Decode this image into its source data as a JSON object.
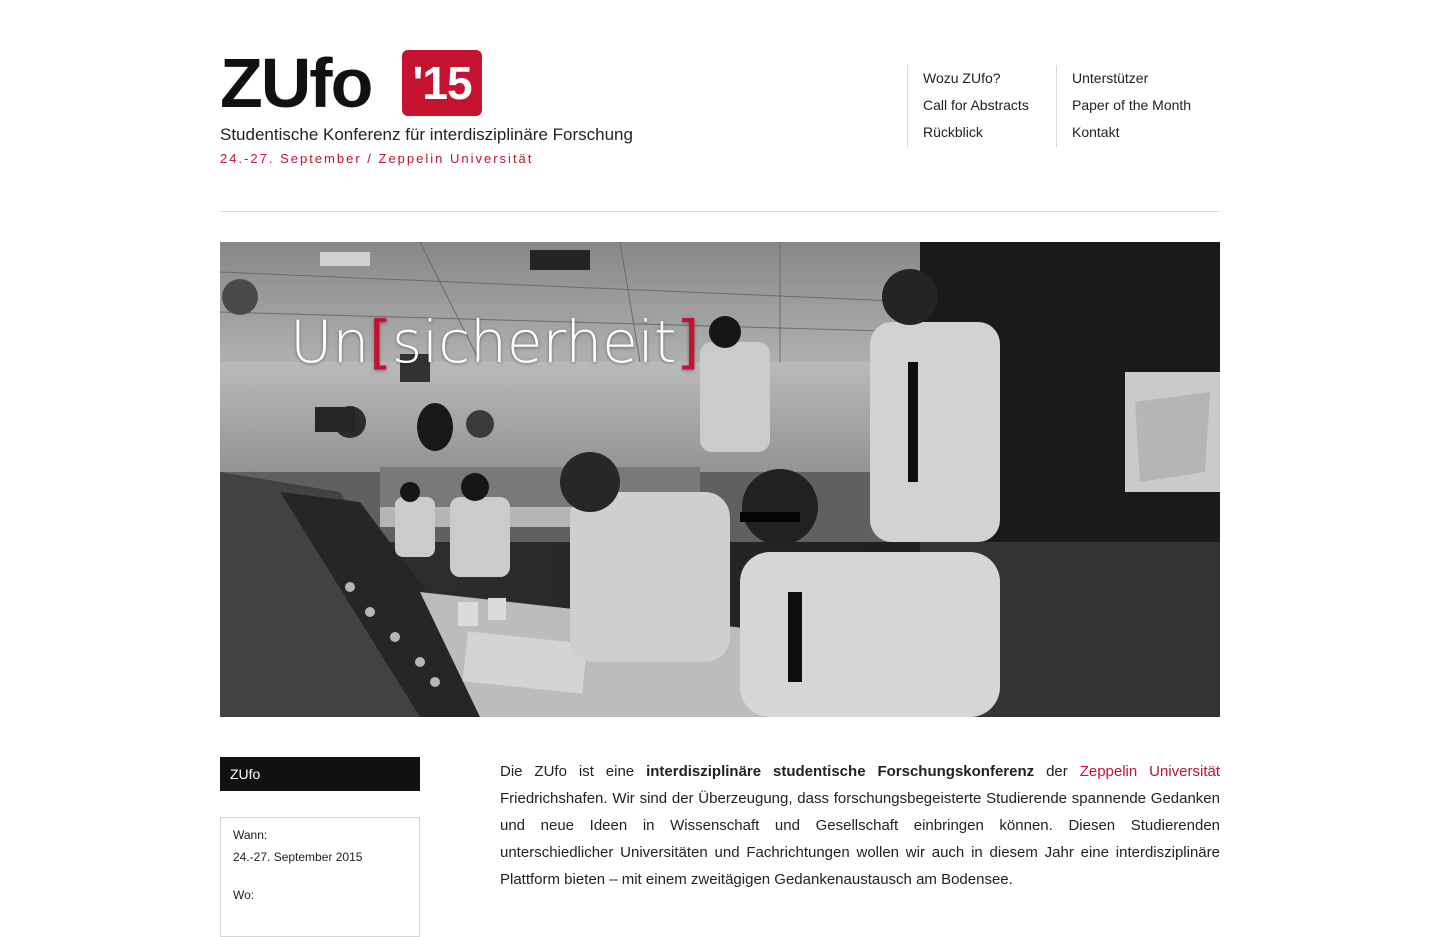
{
  "logo": {
    "word": "ZUfo",
    "year": "'15",
    "tagline": "Studentische Konferenz für interdisziplinäre Forschung",
    "dates": "24.-27. September / Zeppelin Universität"
  },
  "nav": {
    "col1": [
      "Wozu ZUfo?",
      "Call for Abstracts",
      "Rückblick"
    ],
    "col2": [
      "Unterstützer",
      "Paper of the Month",
      "Kontakt"
    ]
  },
  "hero": {
    "title_prefix": "Un",
    "bracket_open": "[",
    "title_word": "sicherheit",
    "bracket_close": "]"
  },
  "sidebar": {
    "heading": "ZUfo",
    "when_label": "Wann:",
    "when_value": "24.-27. September 2015",
    "where_label": "Wo:"
  },
  "intro": {
    "p1": "Die ZUfo ist eine ",
    "bold": "interdisziplinäre studentische Forschungskonferenz",
    "p2": " der ",
    "link": "Zeppelin Universität",
    "p3": " Friedrichshafen. Wir sind der Überzeugung, dass forschungsbegeisterte Studierende spannende Gedanken und neue Ideen in Wissenschaft und Gesellschaft einbringen können. Diesen Studierenden unterschiedlicher Universitäten und Fachrichtungen wollen wir auch in diesem Jahr eine interdisziplinäre Plattform bieten – mit einem zweitägigen Gedankenaustausch am Bodensee."
  },
  "colors": {
    "accent": "#c4122f",
    "dark": "#111111"
  }
}
